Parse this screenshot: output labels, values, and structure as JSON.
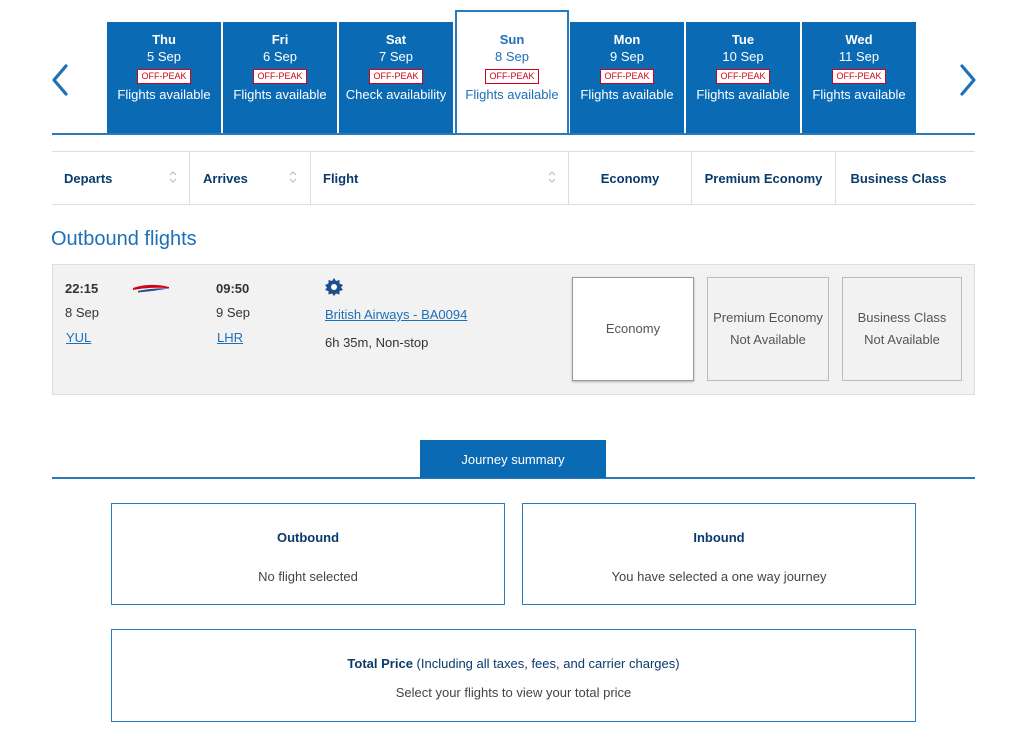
{
  "carousel": {
    "days": [
      {
        "name": "Thu",
        "date": "5 Sep",
        "badge": "OFF-PEAK",
        "status": "Flights available"
      },
      {
        "name": "Fri",
        "date": "6 Sep",
        "badge": "OFF-PEAK",
        "status": "Flights available"
      },
      {
        "name": "Sat",
        "date": "7 Sep",
        "badge": "OFF-PEAK",
        "status": "Check availability"
      },
      {
        "name": "Sun",
        "date": "8 Sep",
        "badge": "OFF-PEAK",
        "status": "Flights available"
      },
      {
        "name": "Mon",
        "date": "9 Sep",
        "badge": "OFF-PEAK",
        "status": "Flights available"
      },
      {
        "name": "Tue",
        "date": "10 Sep",
        "badge": "OFF-PEAK",
        "status": "Flights available"
      },
      {
        "name": "Wed",
        "date": "11 Sep",
        "badge": "OFF-PEAK",
        "status": "Flights available"
      }
    ],
    "selected_index": 3
  },
  "columns": {
    "departs": "Departs",
    "arrives": "Arrives",
    "flight": "Flight",
    "economy": "Economy",
    "premium_economy": "Premium Economy",
    "business": "Business Class"
  },
  "section_title": "Outbound flights",
  "flight": {
    "depart_time": "22:15",
    "depart_date": "8 Sep",
    "depart_airport": "YUL",
    "arrive_time": "09:50",
    "arrive_date": "9 Sep",
    "arrive_airport": "LHR",
    "flight_name": "British Airways - BA0094",
    "duration": "6h 35m, Non-stop",
    "cabins": {
      "economy": "Economy",
      "premium_title": "Premium Economy",
      "premium_status": "Not Available",
      "business_title": "Business Class",
      "business_status": "Not Available"
    }
  },
  "summary": {
    "tab_label": "Journey summary",
    "outbound_title": "Outbound",
    "outbound_text": "No flight selected",
    "inbound_title": "Inbound",
    "inbound_text": "You have selected a one way journey",
    "total_title": "Total Price",
    "total_note": " (Including all taxes, fees, and carrier charges)",
    "total_text": "Select your flights to view your total price"
  },
  "colors": {
    "brand_blue": "#0b6ab4",
    "accent_blue": "#2a7bbd",
    "navy_text": "#0a3a6b",
    "peak_red": "#d0021b"
  },
  "icons": {
    "prev": "chevron-left-icon",
    "next": "chevron-right-icon",
    "airline_logo": "british-airways-logo",
    "flight_badge": "gear-badge-icon",
    "sort": "sort-icon"
  }
}
